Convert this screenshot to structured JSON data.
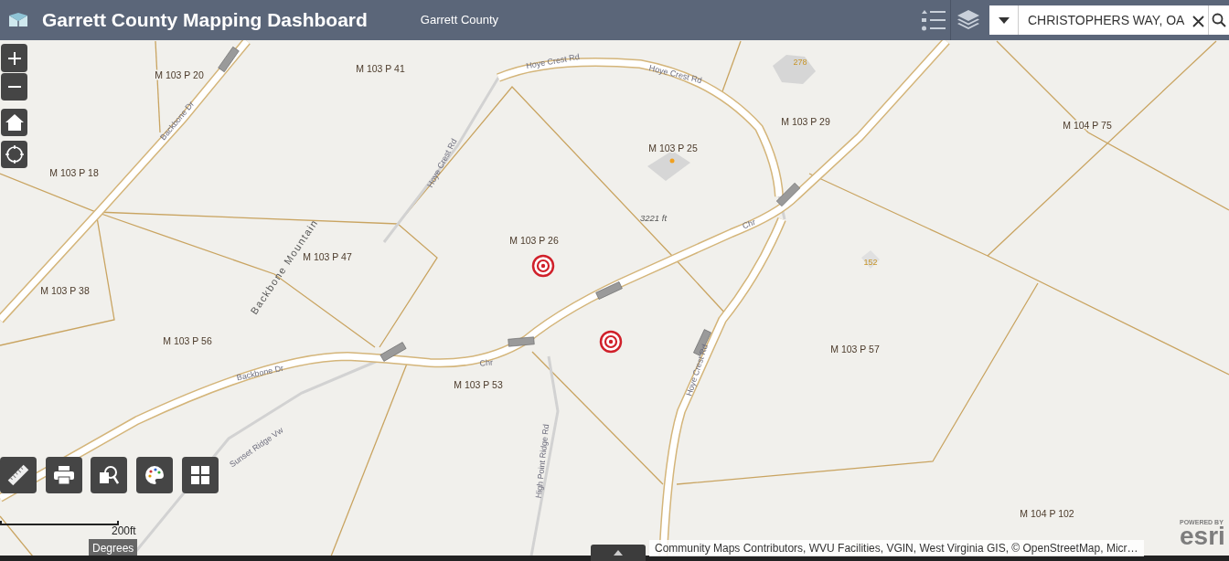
{
  "header": {
    "title": "Garrett County Mapping Dashboard",
    "subtitle": "Garrett County"
  },
  "search": {
    "value": "CHRISTOPHERS WAY, OA"
  },
  "map": {
    "parcel_labels": [
      "M 103 P 20",
      "M 103 P 41",
      "M 103 P 29",
      "M 104 P 75",
      "M 103 P 18",
      "M 103 P 25",
      "M 103 P 26",
      "M 103 P 47",
      "M 103 P 38",
      "M 103 P 56",
      "M 103 P 53",
      "M 103 P 57",
      "M 104 P 102"
    ],
    "road_labels": [
      "Hoye Crest Rd",
      "Hoye Crest Rd",
      "Hoye Crest Rd",
      "Backbone Dr",
      "Backbone Mountain",
      "Backbone Dr",
      "Sunset Ridge Vw",
      "Hoye Crest Rd",
      "High Point Ridge Rd",
      "Chr",
      "Chr"
    ],
    "elevation_label": "3221 ft",
    "building_labels": [
      "278",
      "152"
    ],
    "markers": [
      {
        "kind": "target"
      },
      {
        "kind": "target"
      }
    ]
  },
  "scale": {
    "label": "200ft"
  },
  "coordinates": {
    "label": "Degrees"
  },
  "attribution": "Community Maps Contributors, WVU Facilities, VGIN, West Virginia GIS, © OpenStreetMap, Micr…",
  "logo": {
    "small": "POWERED BY",
    "big": "esri"
  }
}
